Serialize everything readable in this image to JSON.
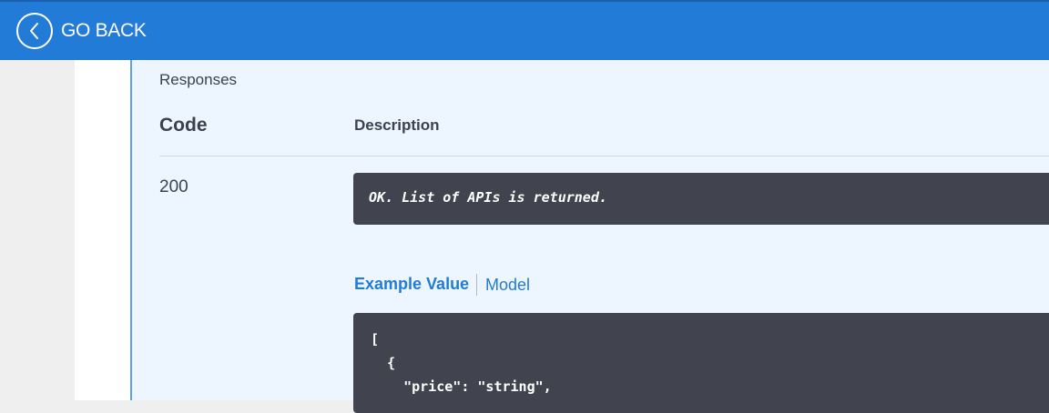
{
  "topbar": {
    "back_label": "GO BACK",
    "icon": "chevron-left-icon",
    "color": "#227bd7"
  },
  "responses": {
    "title": "Responses",
    "headers": {
      "code": "Code",
      "description": "Description"
    },
    "rows": [
      {
        "code": "200",
        "description": "OK. List of APIs is returned.",
        "tabs": {
          "example": "Example Value",
          "model": "Model"
        },
        "example_lines": [
          "[",
          "  {",
          "    \"price\": \"string\","
        ]
      }
    ]
  }
}
